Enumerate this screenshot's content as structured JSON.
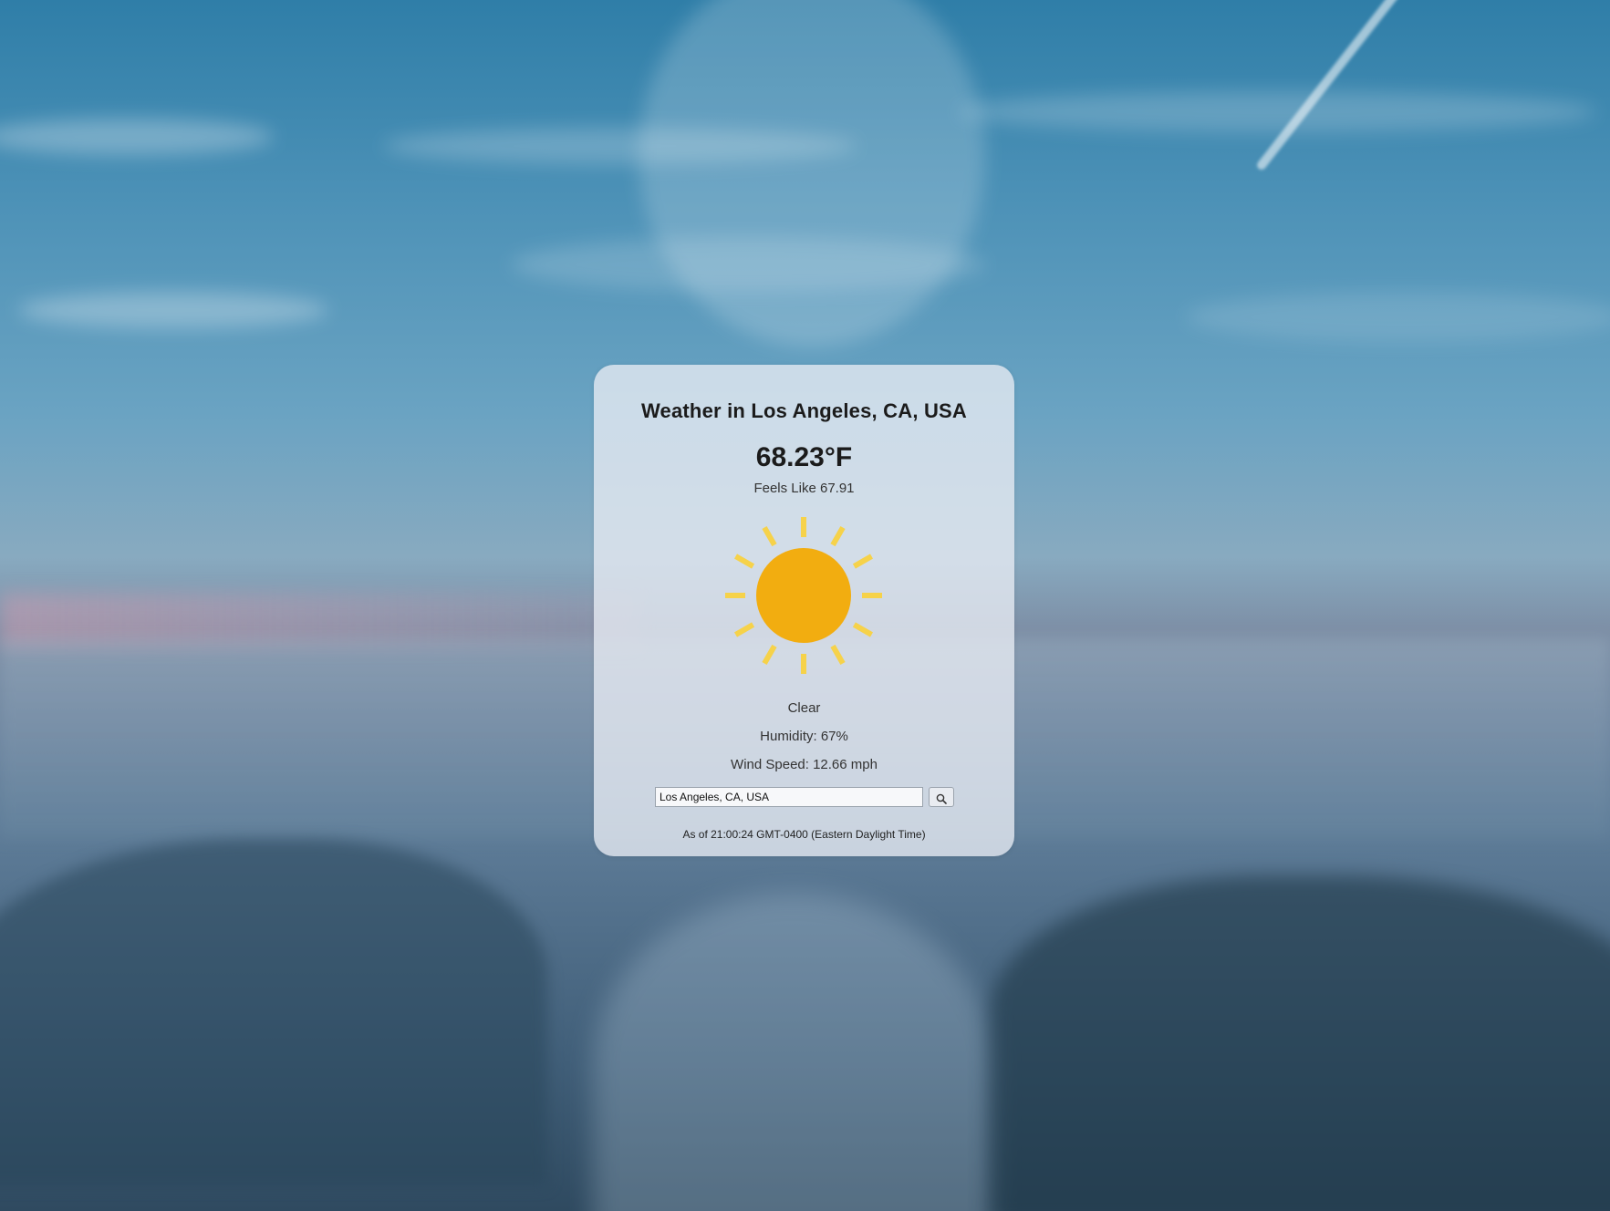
{
  "weather": {
    "title": "Weather in Los Angeles, CA, USA",
    "temperature": "68.23°F",
    "feels_like": "Feels Like 67.91",
    "condition_icon": "sun-icon",
    "description": "Clear",
    "humidity": "Humidity: 67%",
    "wind_speed": "Wind Speed: 12.66 mph",
    "updated": "As of 21:00:24 GMT-0400 (Eastern Daylight Time)"
  },
  "search": {
    "value": "Los Angeles, CA, USA",
    "button_icon": "search-icon"
  },
  "colors": {
    "sun": "#f2ad10",
    "sun_rays": "#f6d24a"
  }
}
